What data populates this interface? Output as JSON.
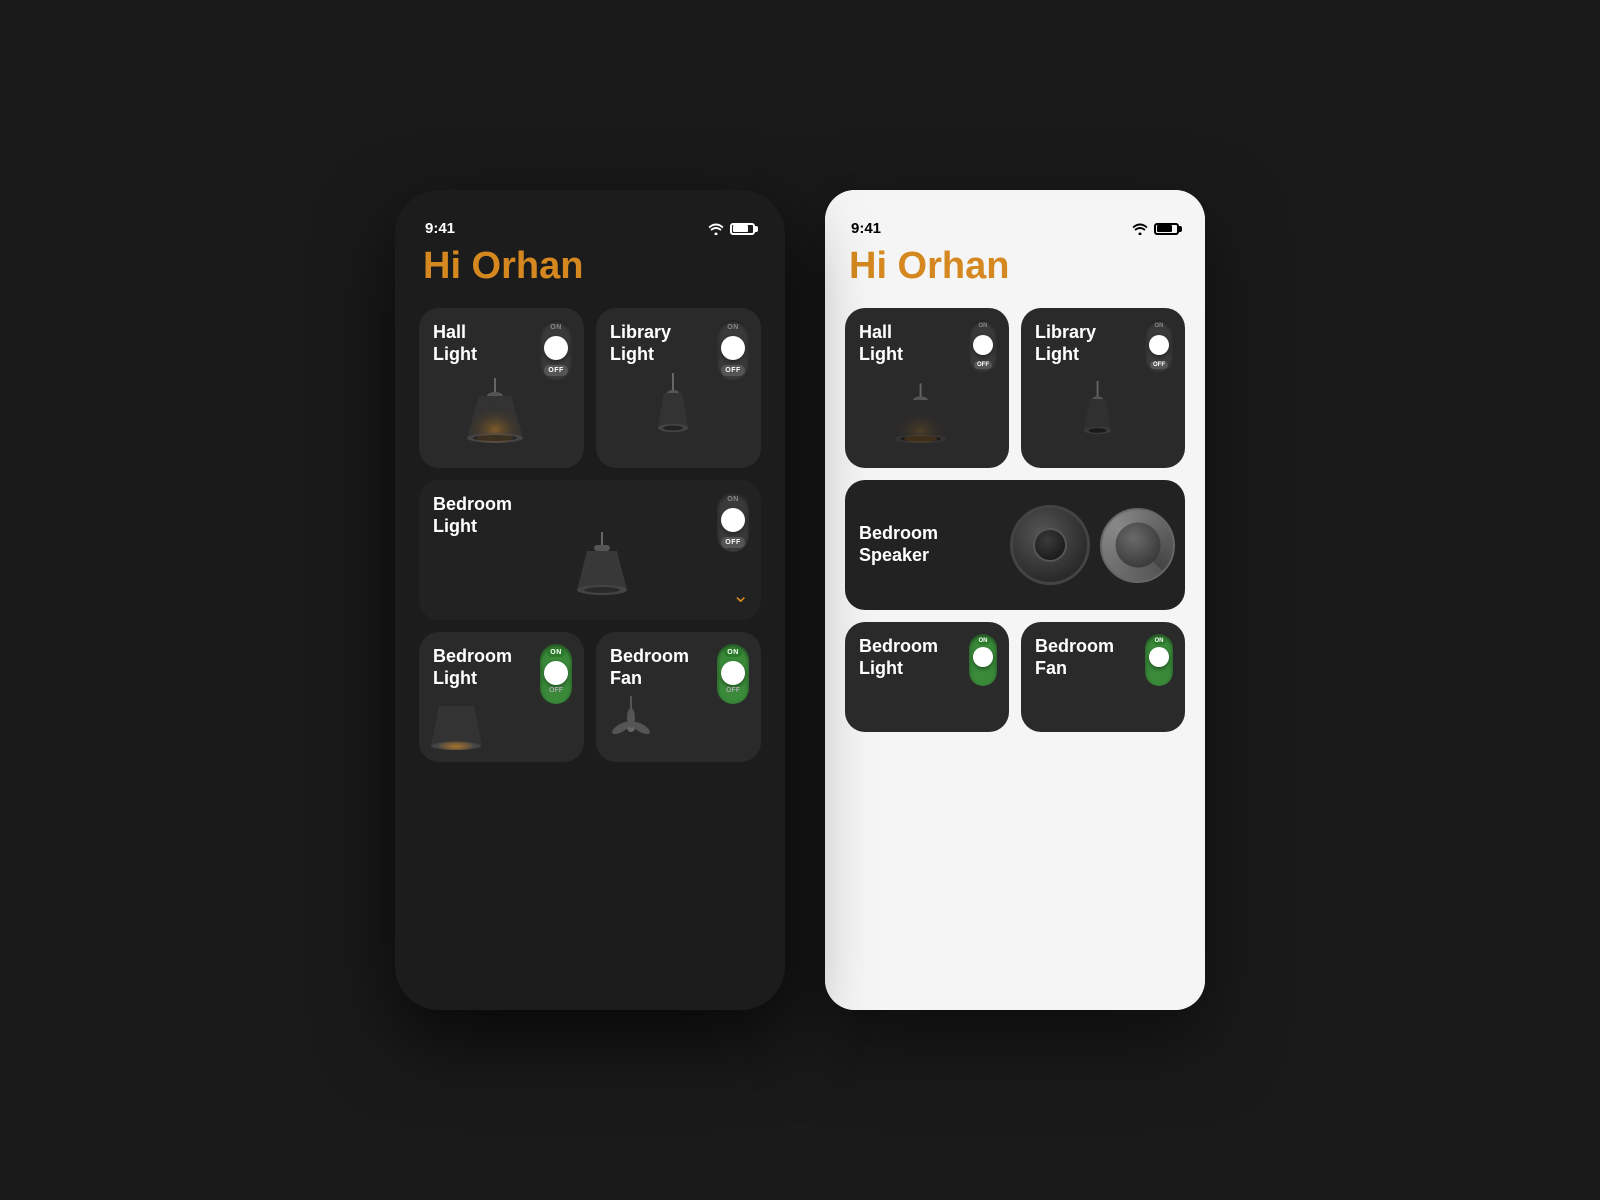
{
  "scene": {
    "background": "#1a1a1a"
  },
  "phone": {
    "status_bar": {
      "time": "9:41"
    },
    "greeting": "Hi Orhan",
    "cards": [
      {
        "id": "hall-light-phone",
        "label": "Hall\nLight",
        "toggle_on": "ON",
        "toggle_off": "OFF",
        "state": "off"
      },
      {
        "id": "library-light-phone",
        "label": "Library\nLight",
        "toggle_on": "ON",
        "toggle_off": "OFF",
        "state": "off"
      },
      {
        "id": "bedroom-light-phone-full",
        "label": "Bedroom\nLight",
        "toggle_on": "ON",
        "toggle_off": "OFF",
        "state": "off"
      },
      {
        "id": "bedroom-light-phone-bottom",
        "label": "Bedroom\nLight",
        "toggle_on": "ON",
        "toggle_off": "OFF",
        "state": "on"
      },
      {
        "id": "bedroom-fan-phone",
        "label": "Bedroom\nFan",
        "toggle_on": "ON",
        "toggle_off": "OFF",
        "state": "off"
      }
    ]
  },
  "tablet": {
    "status_bar": {
      "time": "9:41"
    },
    "greeting": "Hi Orhan",
    "cards": [
      {
        "id": "hall-light-tablet",
        "label": "Hall\nLight",
        "toggle_on": "ON",
        "toggle_off": "OFF",
        "state": "off"
      },
      {
        "id": "library-light-tablet",
        "label": "Library\nLight",
        "toggle_on": "ON",
        "toggle_off": "OFF",
        "state": "off"
      },
      {
        "id": "bedroom-speaker-tablet",
        "label": "Bedroom\nSpeaker",
        "state": "on"
      },
      {
        "id": "bedroom-light-tablet",
        "label": "Bedroom\nLight",
        "toggle_on": "ON",
        "state": "on"
      },
      {
        "id": "bedroom-fan-tablet",
        "label": "Bedroom\nFan",
        "toggle_on": "ON",
        "state": "on"
      }
    ]
  }
}
